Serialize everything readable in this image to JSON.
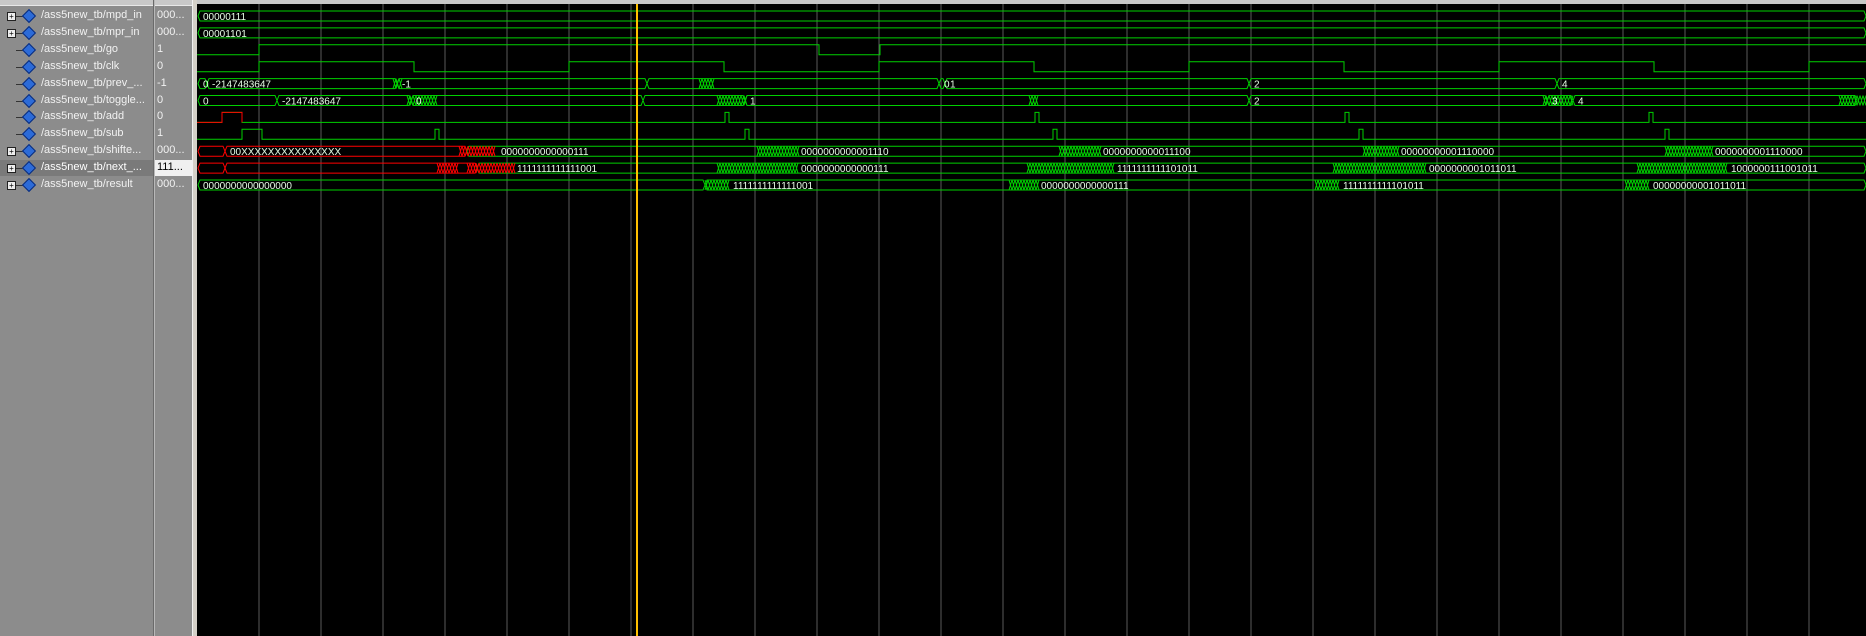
{
  "signals": [
    {
      "name": "/ass5new_tb/mpd_in",
      "value": "000...",
      "expandable": true,
      "selected": false
    },
    {
      "name": "/ass5new_tb/mpr_in",
      "value": "000...",
      "expandable": true,
      "selected": false
    },
    {
      "name": "/ass5new_tb/go",
      "value": "1",
      "expandable": false,
      "selected": false
    },
    {
      "name": "/ass5new_tb/clk",
      "value": "0",
      "expandable": false,
      "selected": false
    },
    {
      "name": "/ass5new_tb/prev_...",
      "value": "-1",
      "expandable": false,
      "selected": false
    },
    {
      "name": "/ass5new_tb/toggle...",
      "value": "0",
      "expandable": false,
      "selected": false
    },
    {
      "name": "/ass5new_tb/add",
      "value": "0",
      "expandable": false,
      "selected": false
    },
    {
      "name": "/ass5new_tb/sub",
      "value": "1",
      "expandable": false,
      "selected": false
    },
    {
      "name": "/ass5new_tb/shifte...",
      "value": "000...",
      "expandable": true,
      "selected": false
    },
    {
      "name": "/ass5new_tb/next_...",
      "value": "111...",
      "expandable": true,
      "selected": true
    },
    {
      "name": "/ass5new_tb/result",
      "value": "000...",
      "expandable": true,
      "selected": false
    }
  ],
  "waveform_labels": {
    "mpd_in": [
      "00000111"
    ],
    "mpr_in": [
      "00001101"
    ],
    "prev": [
      "0",
      "-2147483647",
      "-1",
      "0",
      "1",
      "2",
      "4"
    ],
    "toggle": [
      "0",
      "-2147483647",
      "0",
      "1",
      "2",
      "3",
      "4",
      "4"
    ],
    "shifted": [
      "00XXXXXXXXXXXXXXX",
      "0000000000000111",
      "0000000000001110",
      "0000000000011100",
      "00000000001110000",
      "0000000001110000"
    ],
    "next": [
      "1111111111111001",
      "0000000000000111",
      "1111111111101011",
      "0000000001011011",
      "1000000111001011"
    ],
    "result": [
      "0000000000000000",
      "1111111111111001",
      "0000000000000111",
      "1111111111101011",
      "00000000001011011"
    ]
  },
  "colors": {
    "wave_green": "#00d000",
    "unknown_red": "#ff0000",
    "cursor": "#ffc000",
    "grid": "#5a5a5a",
    "background": "#000000"
  }
}
